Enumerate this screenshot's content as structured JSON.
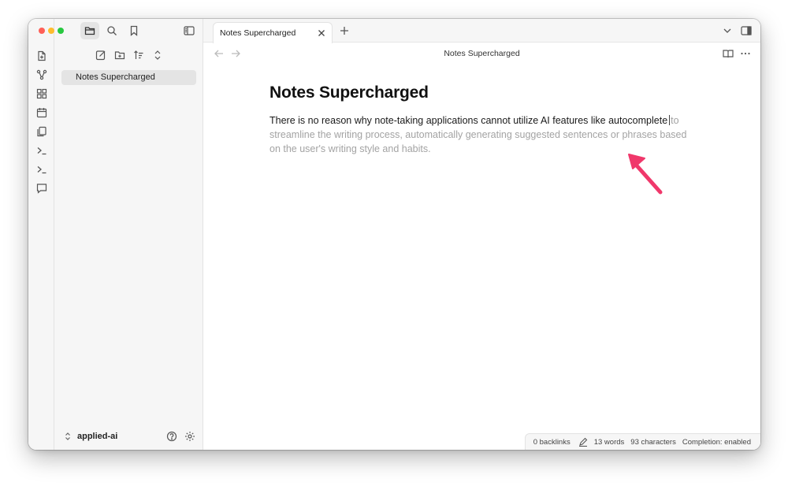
{
  "sidebar": {
    "file_tree": {
      "items": [
        {
          "label": "Notes Supercharged"
        }
      ]
    },
    "vault": {
      "name": "applied-ai"
    }
  },
  "tabs": [
    {
      "label": "Notes Supercharged"
    }
  ],
  "view_header": {
    "title": "Notes Supercharged"
  },
  "note": {
    "title": "Notes Supercharged",
    "typed_text": "There is no reason why note-taking applications cannot utilize AI features like autocomplete",
    "suggestion_text": "to streamline the writing process, automatically generating suggested sentences or phrases based on the user's writing style and habits."
  },
  "status_bar": {
    "backlinks": "0 backlinks",
    "words": "13 words",
    "characters": "93 characters",
    "completion": "Completion: enabled"
  },
  "icons": {
    "ribbon": [
      "file-switcher-icon",
      "graph-icon",
      "canvas-icon",
      "daily-note-icon",
      "templates-icon",
      "command-palette-icon",
      "terminal-icon",
      "chat-icon"
    ],
    "sidebar_top": [
      "folder-icon",
      "search-icon",
      "bookmark-icon",
      "sidebar-toggle-icon"
    ],
    "file_actions": [
      "new-note-icon",
      "new-folder-icon",
      "sort-icon",
      "collapse-icon"
    ]
  },
  "colors": {
    "traffic_close": "#ff5f57",
    "traffic_minimize": "#febc2e",
    "traffic_zoom": "#28c840",
    "suggestion_text": "#a3a3a3",
    "annotation_arrow": "#f0386b"
  }
}
